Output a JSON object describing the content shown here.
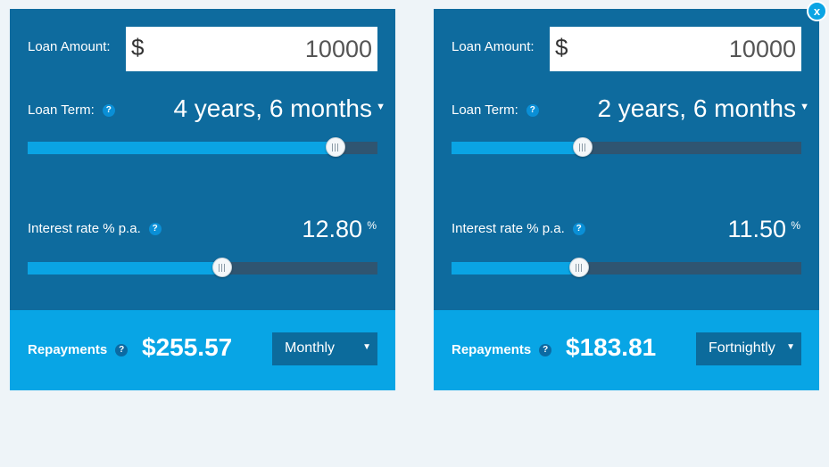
{
  "close_label": "x",
  "calculators": [
    {
      "loan_amount_label": "Loan Amount:",
      "currency_symbol": "$",
      "loan_amount_value": "10000",
      "loan_term_label": "Loan Term:",
      "loan_term_value": "4 years, 6 months",
      "loan_term_fraction": 0.88,
      "interest_label": "Interest rate % p.a.",
      "interest_value": "12.80",
      "interest_unit": "%",
      "interest_fraction": 0.555,
      "help_glyph": "?",
      "repayments_label": "Repayments",
      "repayment_amount": "$255.57",
      "frequency": "Monthly"
    },
    {
      "loan_amount_label": "Loan Amount:",
      "currency_symbol": "$",
      "loan_amount_value": "10000",
      "loan_term_label": "Loan Term:",
      "loan_term_value": "2 years, 6 months",
      "loan_term_fraction": 0.375,
      "interest_label": "Interest rate % p.a.",
      "interest_value": "11.50",
      "interest_unit": "%",
      "interest_fraction": 0.365,
      "help_glyph": "?",
      "repayments_label": "Repayments",
      "repayment_amount": "$183.81",
      "frequency": "Fortnightly"
    }
  ],
  "icons": {
    "help": "question-circle-icon",
    "caret": "caret-down-icon",
    "close": "close-icon"
  },
  "colors": {
    "panel": "#0e6b9e",
    "footer": "#08a5e5",
    "slider_fill": "#0aa4e4",
    "slider_track": "#2f5571",
    "page_background": "#eef4f8"
  }
}
